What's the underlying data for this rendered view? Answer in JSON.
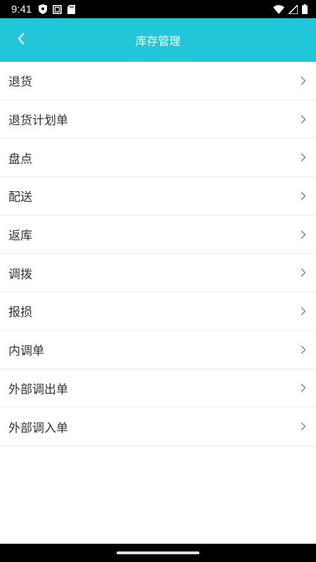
{
  "status_bar": {
    "time": "9:41",
    "icons_left": [
      "shield-icon",
      "square-icon",
      "sd-card-icon"
    ],
    "icons_right": [
      "wifi-icon",
      "signal-icon",
      "battery-icon"
    ]
  },
  "header": {
    "title": "库存管理",
    "background": "#21c7d8",
    "back_icon": "chevron-left-icon"
  },
  "menu": {
    "items": [
      {
        "label": "退货"
      },
      {
        "label": "退货计划单"
      },
      {
        "label": "盘点"
      },
      {
        "label": "配送"
      },
      {
        "label": "返库"
      },
      {
        "label": "调拨"
      },
      {
        "label": "报损"
      },
      {
        "label": "内调单"
      },
      {
        "label": "外部调出单"
      },
      {
        "label": "外部调入单"
      }
    ],
    "item_icon": "chevron-right-icon"
  }
}
